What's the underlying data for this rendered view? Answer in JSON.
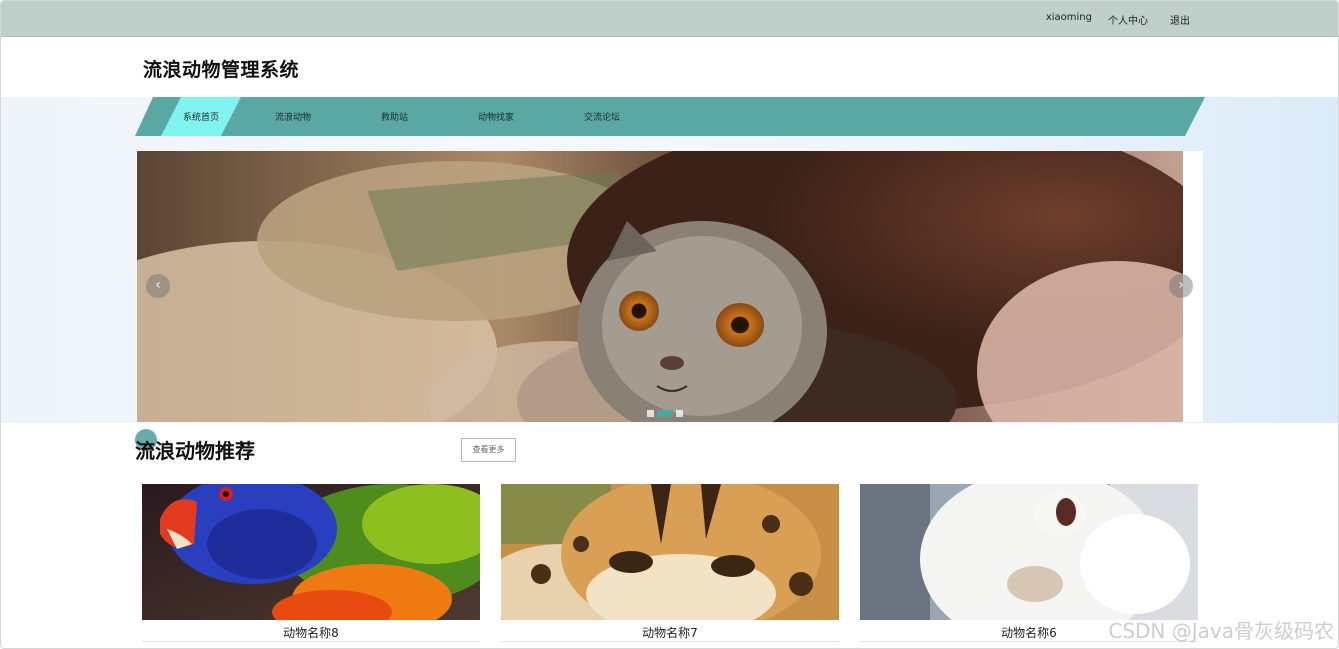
{
  "topbar": {
    "username": "xiaoming",
    "profile_label": "个人中心",
    "logout_label": "退出"
  },
  "header": {
    "title": "流浪动物管理系统"
  },
  "nav": {
    "items": [
      {
        "label": "系统首页",
        "active": true
      },
      {
        "label": "流浪动物",
        "active": false
      },
      {
        "label": "救助站",
        "active": false
      },
      {
        "label": "动物找家",
        "active": false
      },
      {
        "label": "交流论坛",
        "active": false
      }
    ],
    "accent_color": "#5aa8a3",
    "active_color": "#7ff3ef"
  },
  "banner": {
    "prev_icon": "‹",
    "next_icon": "›",
    "slide_count": 3,
    "active_slide": 2
  },
  "recommend": {
    "title": "流浪动物推荐",
    "more_label": "查看更多",
    "cards": [
      {
        "name": "动物名称8"
      },
      {
        "name": "动物名称7"
      },
      {
        "name": "动物名称6"
      }
    ]
  },
  "watermark": "CSDN @Java骨灰级码农"
}
